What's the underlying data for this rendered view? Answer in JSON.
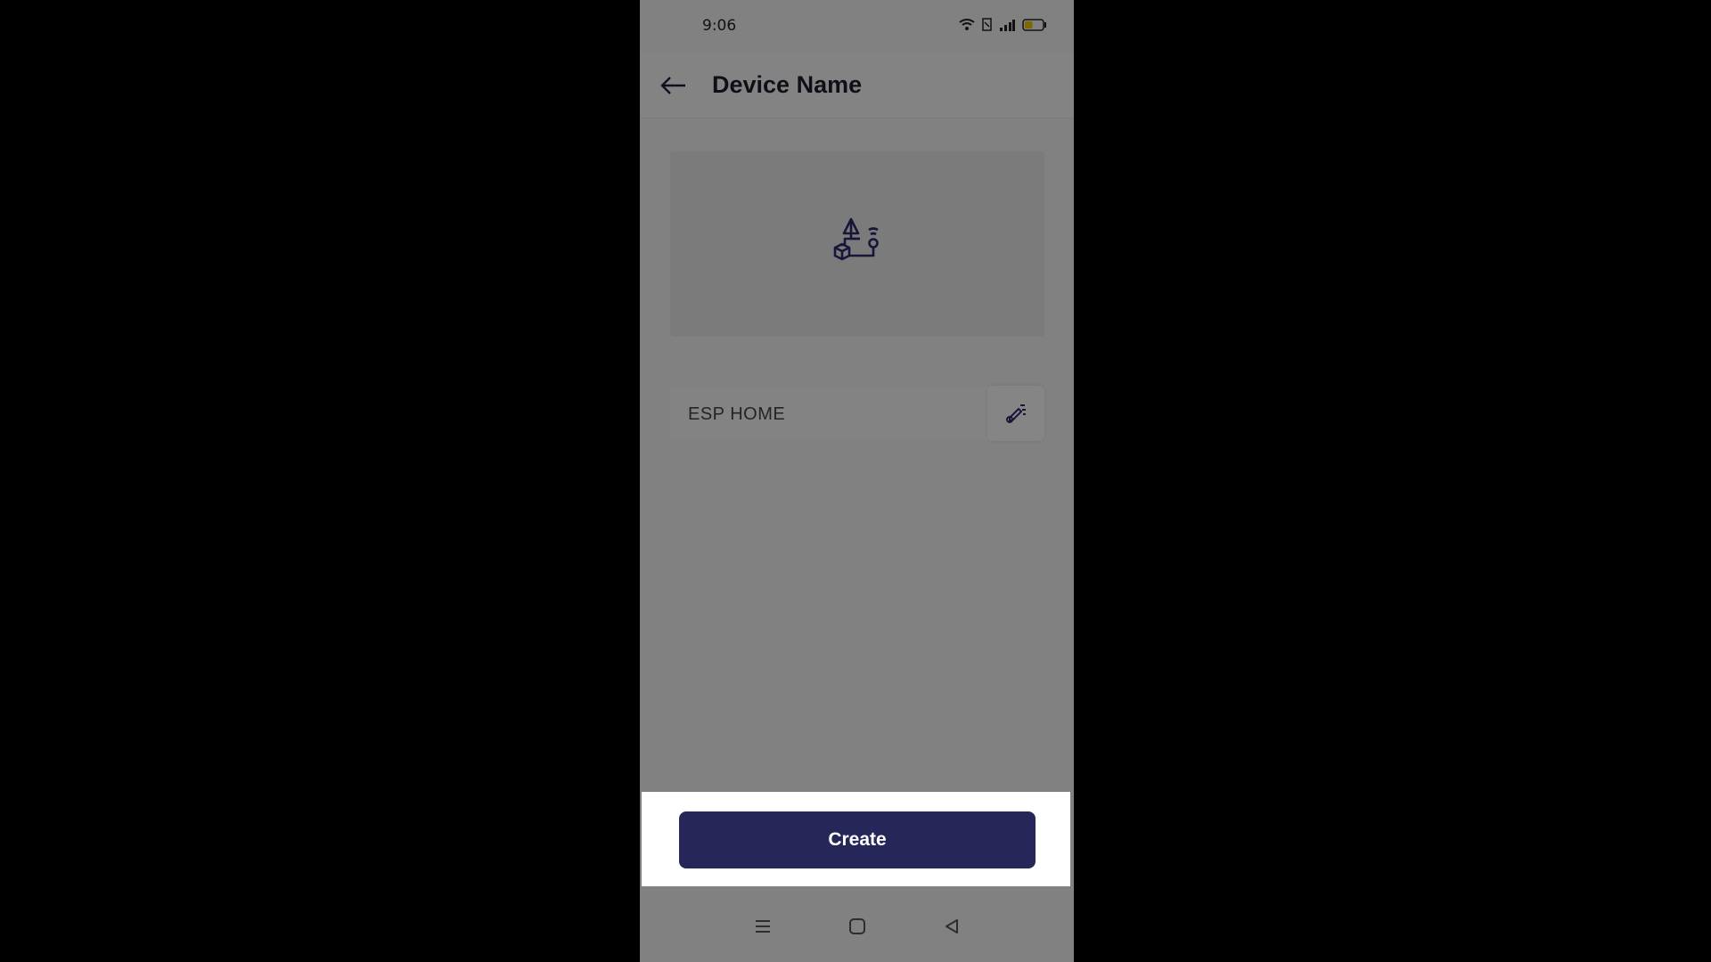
{
  "status_bar": {
    "time": "9:06",
    "battery_level_percent": 45,
    "icons": [
      "wifi-icon",
      "sim-icon",
      "signal-icon",
      "battery-icon"
    ]
  },
  "header": {
    "title": "Device Name",
    "back_icon": "arrow-left-icon"
  },
  "device_card": {
    "icon": "device-shapes-icon"
  },
  "name_field": {
    "value": "ESP HOME",
    "edit_icon": "edit-icon"
  },
  "bottom_sheet": {
    "create_label": "Create"
  },
  "nav_bar": {
    "icons": [
      "menu-icon",
      "home-icon",
      "back-triangle-icon"
    ]
  },
  "colors": {
    "accent": "#262658",
    "icon": "#2b2b6b",
    "overlay": "rgba(0,0,0,0.47)"
  }
}
